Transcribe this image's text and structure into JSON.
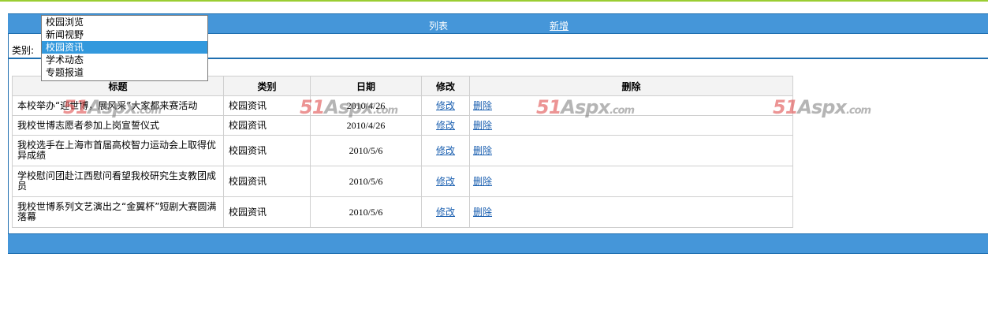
{
  "header": {
    "list_label": "列表",
    "add_label": "新增"
  },
  "filter": {
    "category_label": "类别:",
    "options": [
      "校园浏览",
      "新闻视野",
      "校园资讯",
      "学术动态",
      "专题报道"
    ],
    "selected": "校园资讯"
  },
  "table": {
    "headers": [
      "标题",
      "类别",
      "日期",
      "修改",
      "删除"
    ],
    "rows": [
      {
        "title": "本校举办“迎世博，展风采”大家都来赛活动",
        "category": "校园资讯",
        "date": "2010/4/26",
        "edit": "修改",
        "delete": "删除"
      },
      {
        "title": "我校世博志愿者参加上岗宣誓仪式",
        "category": "校园资讯",
        "date": "2010/4/26",
        "edit": "修改",
        "delete": "删除"
      },
      {
        "title": "我校选手在上海市首届高校智力运动会上取得优异成绩",
        "category": "校园资讯",
        "date": "2010/5/6",
        "edit": "修改",
        "delete": "删除"
      },
      {
        "title": "学校慰问团赴江西慰问看望我校研究生支教团成员",
        "category": "校园资讯",
        "date": "2010/5/6",
        "edit": "修改",
        "delete": "删除"
      },
      {
        "title": "我校世博系列文艺演出之“金翼杯”短剧大赛圆满落幕",
        "category": "校园资讯",
        "date": "2010/5/6",
        "edit": "修改",
        "delete": "删除"
      }
    ]
  },
  "watermark": {
    "brand": "51",
    "mid": "Aspx",
    "domain": ".com"
  },
  "colors": {
    "header_bar": "#4596d9",
    "border": "#1f6fb0",
    "top_stripe": "#9acd32",
    "dropdown_selected": "#3399dd",
    "link": "#1a5fb0"
  }
}
